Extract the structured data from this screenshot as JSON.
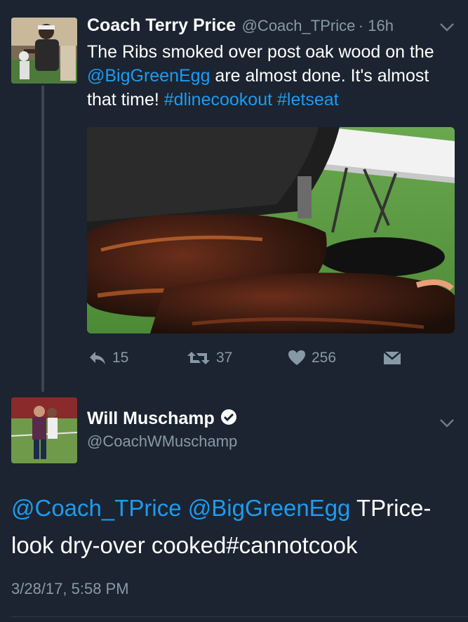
{
  "tweet1": {
    "name": "Coach Terry Price",
    "handle": "@Coach_TPrice",
    "time": "· 16h",
    "text_parts": {
      "p1": "The Ribs smoked over post oak wood on the ",
      "mention": "@BigGreenEgg",
      "p2": " are almost done. It's almost that time! ",
      "hashtag1": "#dlinecookout",
      "space": " ",
      "hashtag2": "#letseat"
    },
    "actions": {
      "reply_count": "15",
      "retweet_count": "37",
      "like_count": "256"
    },
    "icons": {
      "reply": "reply-icon",
      "retweet": "retweet-icon",
      "like": "heart-icon",
      "dm": "envelope-icon",
      "menu": "chevron-down-icon"
    }
  },
  "tweet2": {
    "name": "Will Muschamp",
    "handle": "@CoachWMuschamp",
    "verified": true,
    "text_parts": {
      "mention1": "@Coach_TPrice",
      "space1": " ",
      "mention2": "@BigGreenEgg",
      "p1": " TPrice-look dry-over cooked#cannotcook"
    },
    "date": "3/28/17, 5:58 PM"
  },
  "colors": {
    "background": "#1b2430",
    "link": "#1d9bf0",
    "secondary_text": "#8899a6"
  }
}
